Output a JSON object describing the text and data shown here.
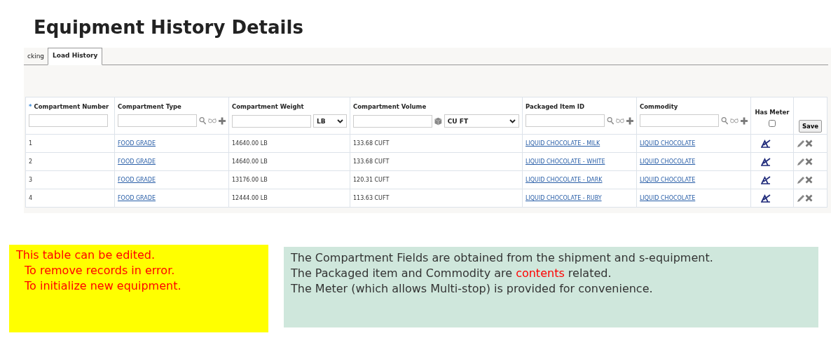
{
  "title": "Equipment History Details",
  "tabs": [
    {
      "label": "cking",
      "selected": false
    },
    {
      "label": "Load History",
      "selected": true
    }
  ],
  "table": {
    "columns": [
      {
        "label": "Compartment Number",
        "required_mark": "*",
        "kind": "text"
      },
      {
        "label": "Compartment Type",
        "kind": "lookup"
      },
      {
        "label": "Compartment Weight",
        "kind": "unit",
        "unit": "LB"
      },
      {
        "label": "Compartment Volume",
        "kind": "volume",
        "unit": "CU FT"
      },
      {
        "label": "Packaged Item ID",
        "kind": "lookup"
      },
      {
        "label": "Commodity",
        "kind": "lookup"
      },
      {
        "label": "Has Meter",
        "kind": "checkbox",
        "checked": false
      },
      {
        "kind": "save",
        "button": "Save"
      }
    ],
    "rows": [
      {
        "number": "1",
        "type": "FOOD GRADE",
        "weight": "14640.00 LB",
        "volume": "133.68 CUFT",
        "item": "LIQUID CHOCOLATE - MILK",
        "commodity": "LIQUID CHOCOLATE"
      },
      {
        "number": "2",
        "type": "FOOD GRADE",
        "weight": "14640.00 LB",
        "volume": "133.68 CUFT",
        "item": "LIQUID CHOCOLATE - WHITE",
        "commodity": "LIQUID CHOCOLATE"
      },
      {
        "number": "3",
        "type": "FOOD GRADE",
        "weight": "13176.00 LB",
        "volume": "120.31 CUFT",
        "item": "LIQUID CHOCOLATE - DARK",
        "commodity": "LIQUID CHOCOLATE"
      },
      {
        "number": "4",
        "type": "FOOD GRADE",
        "weight": "12444.00 LB",
        "volume": "113.63 CUFT",
        "item": "LIQUID CHOCOLATE - RUBY",
        "commodity": "LIQUID CHOCOLATE"
      }
    ]
  },
  "notes": [
    {
      "kind": "warning",
      "lines": [
        [
          {
            "text": "This table can be edited."
          }
        ],
        [
          {
            "text": "To remove records in error."
          }
        ],
        [
          {
            "text": "To initialize new equipment."
          }
        ]
      ]
    },
    {
      "kind": "info",
      "lines": [
        [
          {
            "text": "The Compartment Fields  are obtained from the shipment and s-equipment."
          }
        ],
        [
          {
            "text": "The Packaged item and Commodity are "
          },
          {
            "text": "contents",
            "emphasis": true
          },
          {
            "text": " related."
          }
        ],
        [
          {
            "text": "The Meter (which allows Multi-stop) is provided for convenience."
          }
        ]
      ]
    }
  ]
}
